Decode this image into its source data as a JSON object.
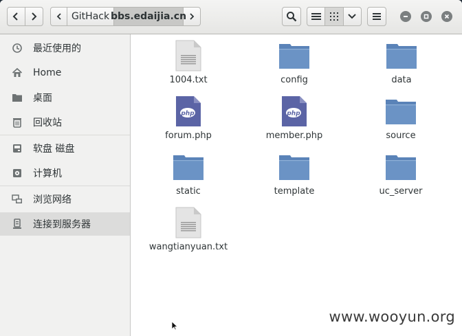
{
  "header": {
    "breadcrumbs": [
      "GitHack",
      "bbs.edaijia.cn"
    ],
    "icons": {
      "back": "chevron-left-icon",
      "forward": "chevron-right-icon",
      "crumb_left": "chevron-left-icon",
      "crumb_right": "chevron-right-icon",
      "search": "search-icon",
      "list_view": "list-view-icon",
      "grid_view": "grid-view-icon",
      "view_options": "chevron-down-icon",
      "menu": "hamburger-menu-icon",
      "minimize": "minimize-icon",
      "maximize": "maximize-icon",
      "close": "close-icon"
    }
  },
  "sidebar": {
    "items": [
      {
        "label": "最近使用的",
        "icon": "recent-icon"
      },
      {
        "label": "Home",
        "icon": "home-icon"
      },
      {
        "label": "桌面",
        "icon": "folder-icon"
      },
      {
        "label": "回收站",
        "icon": "trash-icon"
      },
      {
        "label": "软盘 磁盘",
        "icon": "drive-icon"
      },
      {
        "label": "计算机",
        "icon": "computer-icon"
      },
      {
        "label": "浏览网络",
        "icon": "network-icon"
      },
      {
        "label": "连接到服务器",
        "icon": "server-icon"
      }
    ],
    "selected": "连接到服务器"
  },
  "files": [
    {
      "name": "1004.txt",
      "type": "text"
    },
    {
      "name": "config",
      "type": "folder"
    },
    {
      "name": "data",
      "type": "folder"
    },
    {
      "name": "forum.php",
      "type": "php"
    },
    {
      "name": "member.php",
      "type": "php"
    },
    {
      "name": "source",
      "type": "folder"
    },
    {
      "name": "static",
      "type": "folder"
    },
    {
      "name": "template",
      "type": "folder"
    },
    {
      "name": "uc_server",
      "type": "folder"
    },
    {
      "name": "wangtianyuan.txt",
      "type": "text"
    }
  ],
  "php_badge": "php",
  "watermark": "www.wooyun.org",
  "colors": {
    "folder": "#6b93c5",
    "folder_tab": "#5a83b8",
    "php": "#5b64a5",
    "selected_bg": "#dcdcdb"
  }
}
